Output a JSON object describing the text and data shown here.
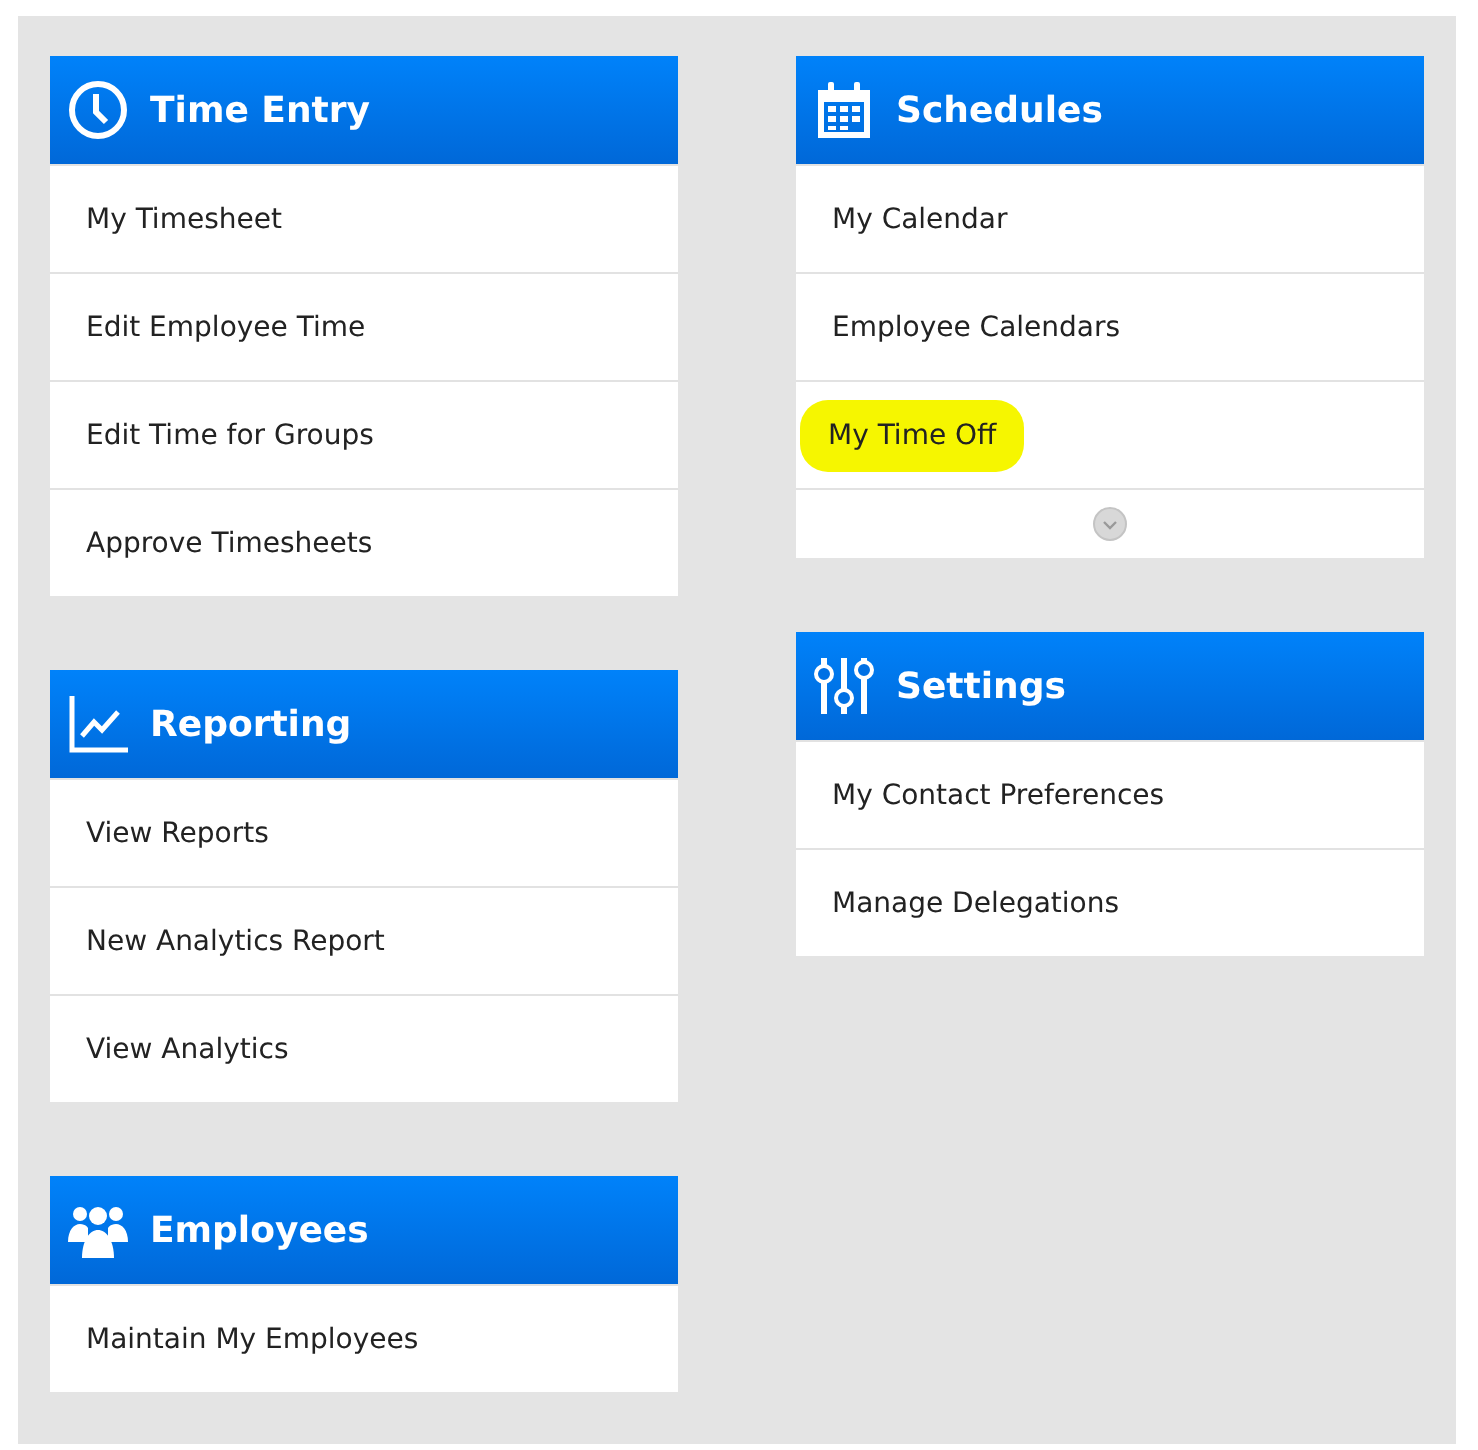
{
  "columns": [
    {
      "panels": [
        {
          "title": "Time Entry",
          "items": [
            {
              "label": "My Timesheet",
              "highlighted": false
            },
            {
              "label": "Edit Employee Time",
              "highlighted": false
            },
            {
              "label": "Edit Time for Groups",
              "highlighted": false
            },
            {
              "label": "Approve Timesheets",
              "highlighted": false
            }
          ],
          "has_more": false
        },
        {
          "title": "Reporting",
          "items": [
            {
              "label": "View Reports",
              "highlighted": false
            },
            {
              "label": "New Analytics Report",
              "highlighted": false
            },
            {
              "label": "View Analytics",
              "highlighted": false
            }
          ],
          "has_more": false
        },
        {
          "title": "Employees",
          "items": [
            {
              "label": "Maintain My Employees",
              "highlighted": false
            }
          ],
          "has_more": false
        }
      ]
    },
    {
      "panels": [
        {
          "title": "Schedules",
          "items": [
            {
              "label": "My Calendar",
              "highlighted": false
            },
            {
              "label": "Employee Calendars",
              "highlighted": false
            },
            {
              "label": "My Time Off",
              "highlighted": true
            }
          ],
          "has_more": true
        },
        {
          "title": "Settings",
          "items": [
            {
              "label": "My Contact Preferences",
              "highlighted": false
            },
            {
              "label": "Manage Delegations",
              "highlighted": false
            }
          ],
          "has_more": false
        }
      ]
    }
  ]
}
